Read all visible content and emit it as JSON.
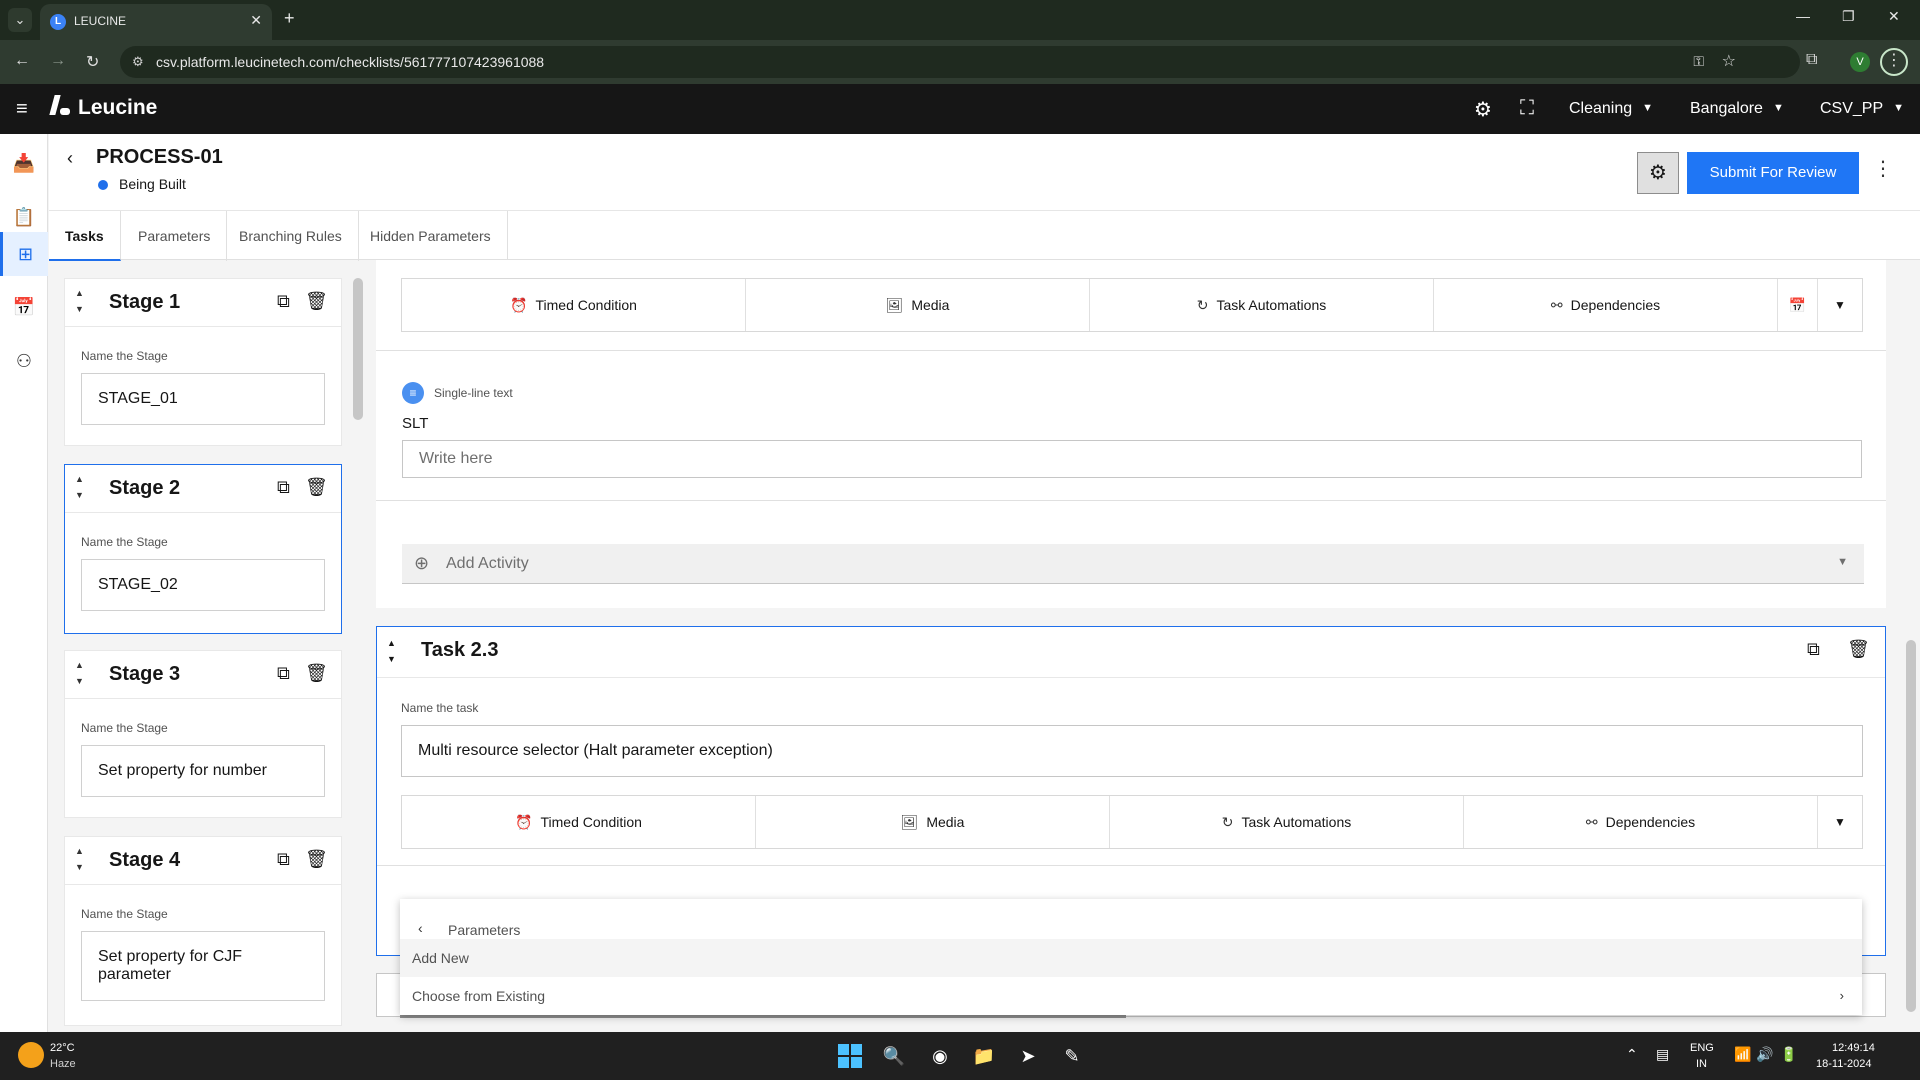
{
  "browser": {
    "tab_title": "LEUCINE",
    "url": "csv.platform.leucinetech.com/checklists/561777107423961088",
    "profile_initial": "V"
  },
  "app": {
    "brand": "Leucine",
    "selectors": {
      "use_case": "Cleaning",
      "facility": "Bangalore",
      "account": "CSV_PP"
    }
  },
  "page": {
    "title": "PROCESS-01",
    "status": "Being Built",
    "submit_label": "Submit For Review",
    "tabs": [
      "Tasks",
      "Parameters",
      "Branching Rules",
      "Hidden Parameters"
    ],
    "active_tab": "Tasks"
  },
  "stages": {
    "name_label": "Name the Stage",
    "items": [
      {
        "title": "Stage 1",
        "value": "STAGE_01"
      },
      {
        "title": "Stage 2",
        "value": "STAGE_02"
      },
      {
        "title": "Stage 3",
        "value": "Set property for number"
      },
      {
        "title": "Stage 4",
        "value": "Set property for CJF parameter"
      }
    ]
  },
  "task_toolbar": {
    "timed": "Timed Condition",
    "media": "Media",
    "automations": "Task Automations",
    "dependencies": "Dependencies"
  },
  "parameter": {
    "type_label": "Single-line text",
    "name": "SLT",
    "placeholder": "Write here"
  },
  "add_activity": "Add Activity",
  "task": {
    "title": "Task 2.3",
    "name_label": "Name the task",
    "name_value": "Multi resource selector (Halt parameter exception)"
  },
  "param_menu": {
    "header": "Parameters",
    "items": [
      "Add New",
      "Choose from Existing"
    ]
  },
  "taskbar": {
    "temperature": "22°C",
    "weather": "Haze",
    "lang1": "ENG",
    "lang2": "IN",
    "time": "12:49:14",
    "date": "18-11-2024"
  }
}
